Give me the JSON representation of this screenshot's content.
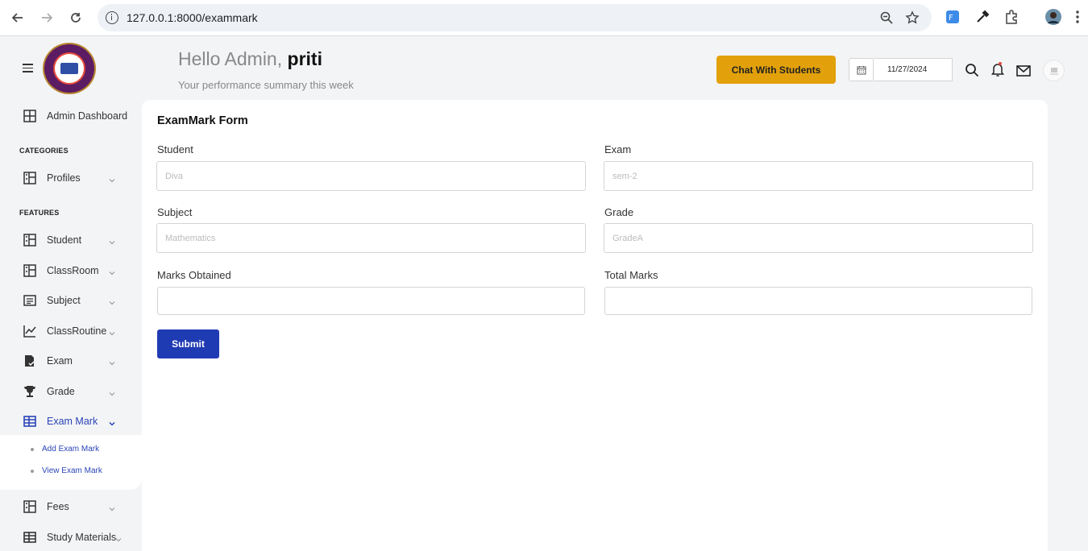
{
  "browser": {
    "url": "127.0.0.1:8000/exammark"
  },
  "sidebar": {
    "dashboard_label": "Admin Dashboard",
    "categories_title": "CATEGORIES",
    "features_title": "FEATURES",
    "items": [
      {
        "label": "Profiles"
      },
      {
        "label": "Student"
      },
      {
        "label": "ClassRoom"
      },
      {
        "label": "Subject"
      },
      {
        "label": "ClassRoutine"
      },
      {
        "label": "Exam"
      },
      {
        "label": "Grade"
      },
      {
        "label": "Exam Mark"
      },
      {
        "label": "Fees"
      },
      {
        "label": "Study Materials"
      }
    ],
    "submenu": [
      {
        "label": "Add Exam Mark"
      },
      {
        "label": "View Exam Mark"
      }
    ]
  },
  "header": {
    "hello": "Hello Admin,",
    "username": "priti",
    "subtitle": "Your performance summary this week",
    "chat_button": "Chat With Students",
    "date": "11/27/2024"
  },
  "form": {
    "title": "ExamMark Form",
    "fields": {
      "student": {
        "label": "Student",
        "placeholder": "Diva"
      },
      "exam": {
        "label": "Exam",
        "placeholder": "sem-2"
      },
      "subject": {
        "label": "Subject",
        "placeholder": "Mathematics"
      },
      "grade": {
        "label": "Grade",
        "placeholder": "GradeA"
      },
      "marks_obtained": {
        "label": "Marks Obtained",
        "placeholder": ""
      },
      "total_marks": {
        "label": "Total Marks",
        "placeholder": ""
      }
    },
    "submit_label": "Submit"
  },
  "colors": {
    "accent_blue": "#1f3bb3",
    "chat_button": "#e2a10b",
    "active_menu": "#2b44b7"
  },
  "icons": [
    "back-icon",
    "forward-icon",
    "reload-icon",
    "info-icon",
    "zoom-icon",
    "star-icon",
    "extension-icon",
    "eyedropper-icon",
    "puzzle-icon",
    "profile-icon",
    "kebab-icon",
    "menu-icon",
    "calendar-icon",
    "search-icon",
    "bell-icon",
    "mail-icon"
  ]
}
